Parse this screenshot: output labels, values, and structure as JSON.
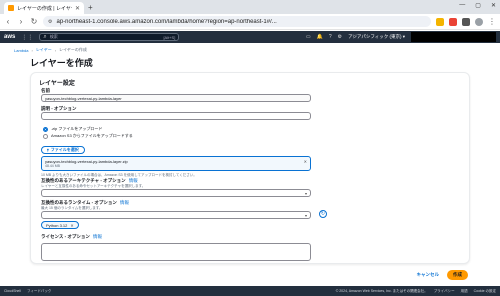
{
  "browser": {
    "tab_title": "レイヤーの作成 | レイヤー | Lambda",
    "url": "ap-northeast-1.console.aws.amazon.com/lambda/home?region=ap-northeast-1#/..."
  },
  "aws": {
    "logo": "aws",
    "search_placeholder": "検索",
    "search_shortcut": "[Alt+S]",
    "account_label": "アジアパシフィック (東京) ▾"
  },
  "breadcrumb": {
    "lambda": "Lambda",
    "layers": "レイヤー",
    "current": "レイヤーの作成"
  },
  "page": {
    "title": "レイヤーを作成"
  },
  "form": {
    "section_title": "レイヤー設定",
    "name_label": "名前",
    "name_value": "yasuyon-techblog-vertexai-py-lambda-layer",
    "description_label": "説明 - オプション",
    "upload_zip": ".zip ファイルをアップロード",
    "upload_s3": "Amazon S3 からファイルをアップロードする",
    "upload_button": "ファイルを選択",
    "file_name": "yasuyon-techblog-vertexai-py-lambda-layer.zip",
    "file_size": "48.44 MB",
    "file_hint": "10 MB よりも大きいファイルの場合は、Amazon S3 を使用してアップロードを検討してください。",
    "arch_label": "互換性のあるアーキテクチャ - オプション",
    "arch_info": "情報",
    "arch_desc": "レイヤーと互換性のある命令セットアーキテクチャを選択します。",
    "runtime_label": "互換性のあるランタイム - オプション",
    "runtime_info": "情報",
    "runtime_desc": "最大 15 個のランタイムを選択します。",
    "runtime_tag": "Python 3.12",
    "license_label": "ライセンス - オプション",
    "license_info": "情報"
  },
  "actions": {
    "cancel": "キャンセル",
    "create": "作成"
  },
  "footer": {
    "cloudshell": "CloudShell",
    "feedback": "フィードバック",
    "copyright": "© 2024, Amazon Web Services, Inc. またはその関連会社。",
    "privacy": "プライバシー",
    "terms": "用語",
    "cookie": "Cookie の設定"
  }
}
